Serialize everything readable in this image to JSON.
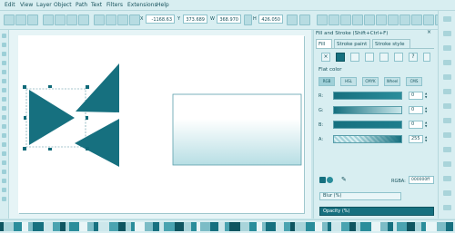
{
  "menu": [
    "Edit",
    "View",
    "Layer",
    "Object",
    "Path",
    "Text",
    "Filters",
    "Extensions",
    "Help"
  ],
  "toolbar": {
    "x_label": "X",
    "x_value": "-1168.63",
    "y_label": "Y",
    "y_value": "373.689",
    "w_label": "W",
    "w_value": "368.970",
    "h_label": "H",
    "h_value": "426.050"
  },
  "panel": {
    "title": "Fill and Stroke (Shift+Ctrl+F)",
    "tabs": [
      "Fill",
      "Stroke paint",
      "Stroke style"
    ],
    "section_label": "Flat color",
    "color_models": [
      "RGB",
      "HSL",
      "CMYK",
      "Wheel",
      "CMS"
    ],
    "channels": [
      {
        "label": "R:",
        "value": "0"
      },
      {
        "label": "G:",
        "value": "0"
      },
      {
        "label": "B:",
        "value": "0"
      },
      {
        "label": "A:",
        "value": "255"
      }
    ],
    "rgba_label": "RGBA:",
    "rgba_value": "000000ff",
    "blur_label": "Blur (%)",
    "opacity_label": "Opacity (%)"
  },
  "colors": {
    "accent": "#16707f",
    "dark": "#0f6a79",
    "panel_bg": "#d8eef1",
    "canvas_bg": "#e6f4f6"
  }
}
